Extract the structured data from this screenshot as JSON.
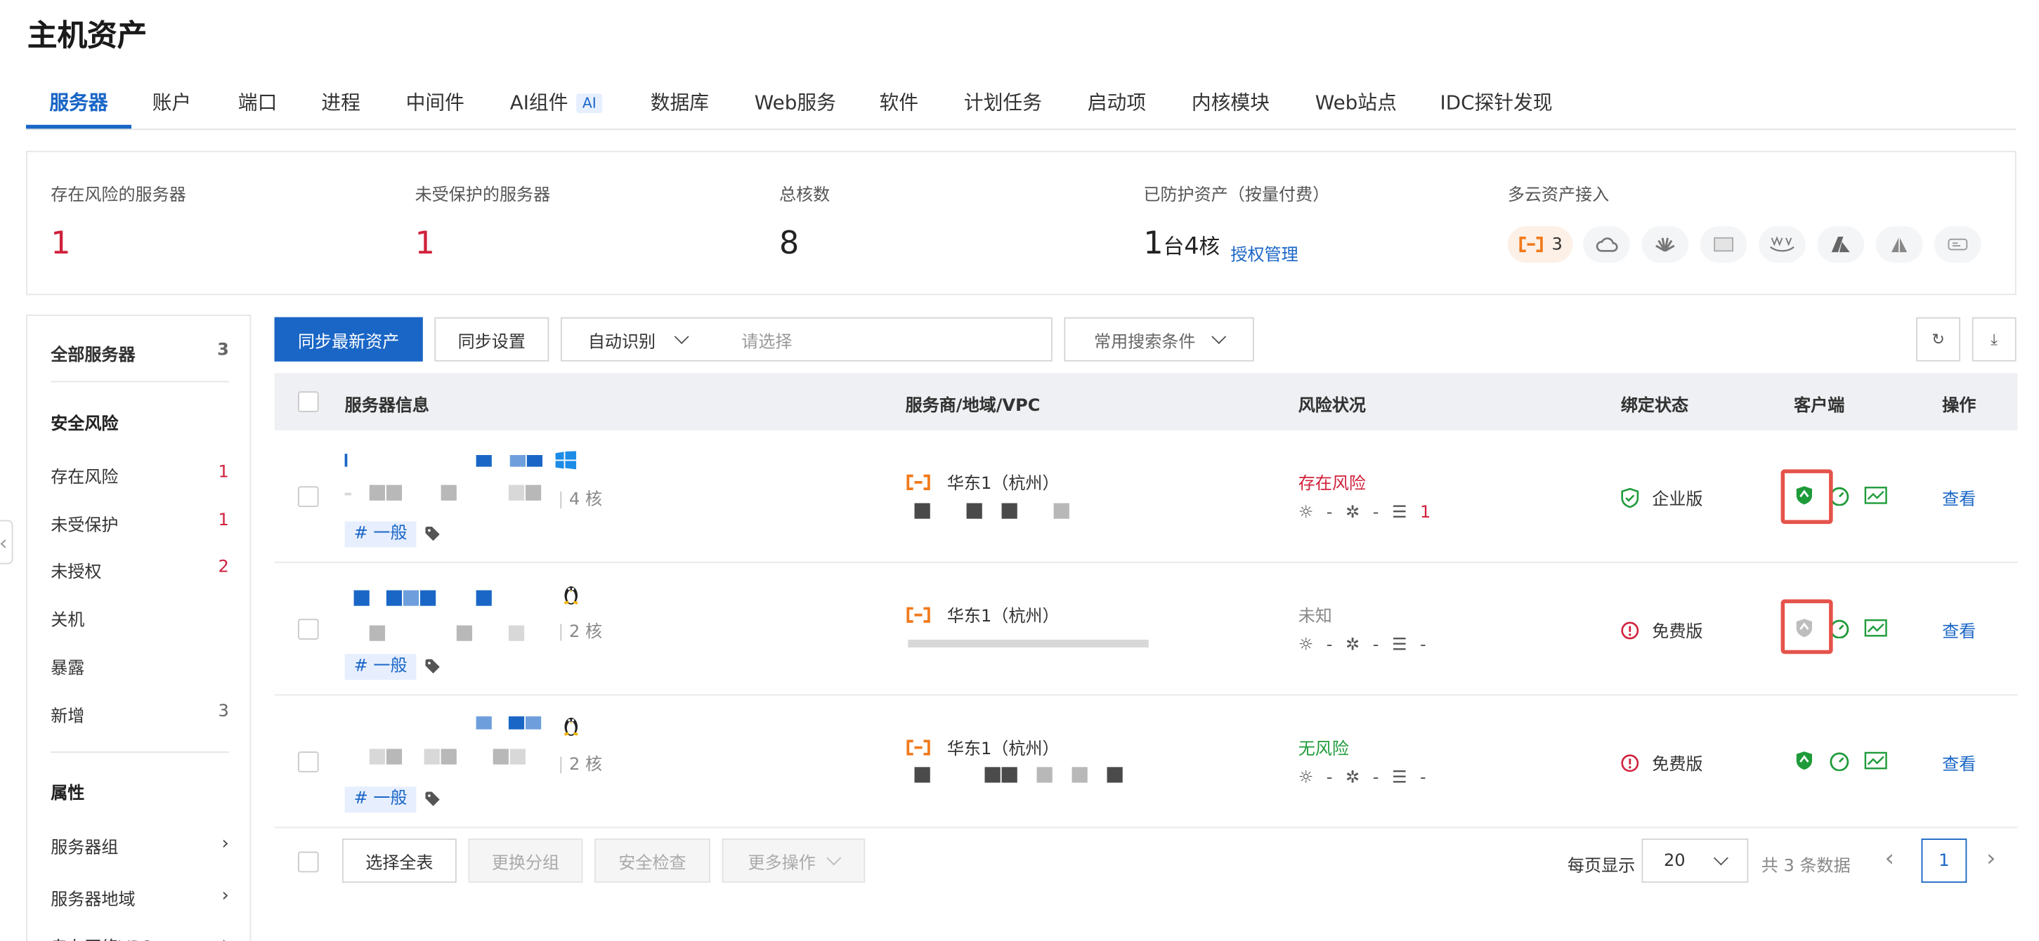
{
  "page": {
    "title": "主机资产"
  },
  "tabs": [
    {
      "label": "服务器"
    },
    {
      "label": "账户"
    },
    {
      "label": "端口"
    },
    {
      "label": "进程"
    },
    {
      "label": "中间件"
    },
    {
      "label": "AI组件",
      "badge": "AI"
    },
    {
      "label": "数据库"
    },
    {
      "label": "Web服务"
    },
    {
      "label": "软件"
    },
    {
      "label": "计划任务"
    },
    {
      "label": "启动项"
    },
    {
      "label": "内核模块"
    },
    {
      "label": "Web站点"
    },
    {
      "label": "IDC探针发现"
    }
  ],
  "stats": {
    "risk": {
      "label": "存在风险的服务器",
      "value": "1"
    },
    "unprotected": {
      "label": "未受保护的服务器",
      "value": "1"
    },
    "cores": {
      "label": "总核数",
      "value": "8"
    },
    "protected": {
      "label": "已防护资产（按量付费）",
      "num1": "1",
      "unit1": "台",
      "num2": "4",
      "unit2": "核",
      "link": "授权管理"
    },
    "multicloud": {
      "label": "多云资产接入",
      "aliyun_count": "3",
      "providers": [
        "aliyun-icon",
        "cloud-icon",
        "huawei-icon",
        "idc-icon",
        "aws-icon",
        "azure-icon",
        "google-icon",
        "other-cloud-icon"
      ]
    }
  },
  "sidebar": {
    "all": {
      "label": "全部服务器",
      "count": "3"
    },
    "risk_title": "安全风险",
    "risk_items": [
      {
        "label": "存在风险",
        "count": "1"
      },
      {
        "label": "未受保护",
        "count": "1"
      },
      {
        "label": "未授权",
        "count": "2"
      },
      {
        "label": "关机",
        "count": ""
      },
      {
        "label": "暴露",
        "count": ""
      },
      {
        "label": "新增",
        "count": "3"
      }
    ],
    "attr_title": "属性",
    "attr_items": [
      {
        "label": "服务器组"
      },
      {
        "label": "服务器地域"
      },
      {
        "label": "专有网络VPC"
      }
    ]
  },
  "toolbar": {
    "sync_latest": "同步最新资产",
    "sync_settings": "同步设置",
    "auto_identify": "自动识别",
    "search_placeholder": "请选择",
    "common_search": "常用搜索条件"
  },
  "table": {
    "headers": {
      "server_info": "服务器信息",
      "provider": "服务商/地域/VPC",
      "risk": "风险状况",
      "bind": "绑定状态",
      "client": "客户端",
      "action": "操作"
    },
    "rows": [
      {
        "os": "windows",
        "cores": "4 核",
        "tag": "# 一般",
        "region": "华东1（杭州）",
        "risk_status": "存在风险",
        "risk_type": "red",
        "alerts": "-",
        "vulns": "-",
        "baseline": "1",
        "edition": "企业版",
        "edition_type": "ok",
        "client_state": "online",
        "highlight": true,
        "action": "查看"
      },
      {
        "os": "linux",
        "cores": "2 核",
        "tag": "# 一般",
        "region": "华东1（杭州）",
        "risk_status": "未知",
        "risk_type": "gray",
        "alerts": "-",
        "vulns": "-",
        "baseline": "-",
        "edition": "免费版",
        "edition_type": "warn",
        "client_state": "offline",
        "highlight": true,
        "action": "查看"
      },
      {
        "os": "linux",
        "cores": "2 核",
        "tag": "# 一般",
        "region": "华东1（杭州）",
        "risk_status": "无风险",
        "risk_type": "green",
        "alerts": "-",
        "vulns": "-",
        "baseline": "-",
        "edition": "免费版",
        "edition_type": "warn",
        "client_state": "online",
        "highlight": false,
        "action": "查看"
      }
    ]
  },
  "footer": {
    "select_all": "选择全表",
    "change_group": "更换分组",
    "security_check": "安全检查",
    "more_actions": "更多操作",
    "per_page_label": "每页显示",
    "per_page_value": "20",
    "total": "共 3 条数据",
    "current_page": "1"
  },
  "colors": {
    "accent": "#1a66c6",
    "danger": "#d0213b",
    "success": "#1f9b3a",
    "highlight": "#e5534b"
  }
}
